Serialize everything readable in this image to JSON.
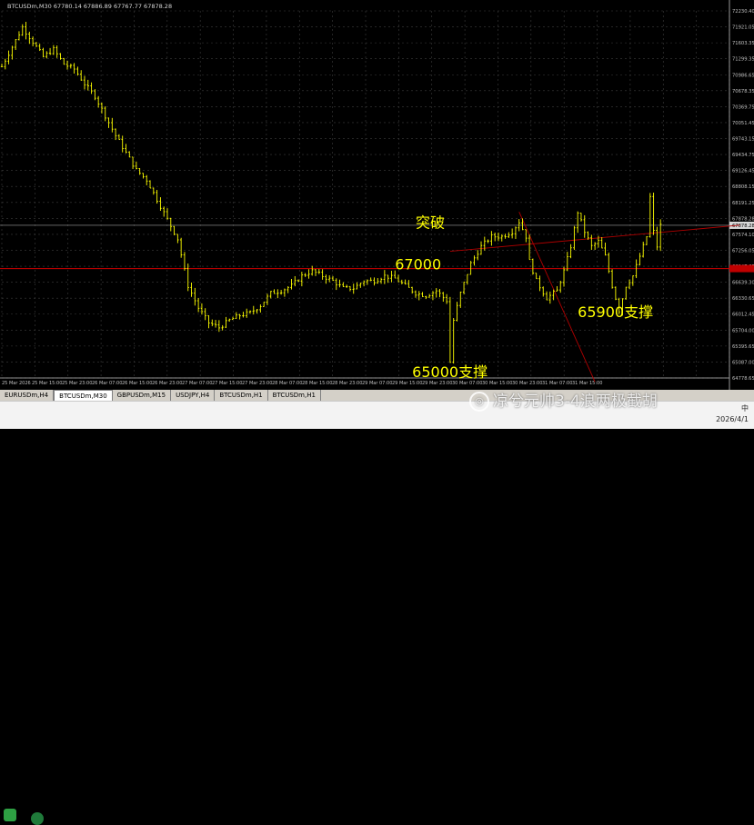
{
  "window": {
    "title": "BTCUSDm,M30  67780.14 67886.89 67767.77 67878.28"
  },
  "tabs": [
    {
      "label": "EURUSDm,H4",
      "active": false
    },
    {
      "label": "BTCUSDm,M30",
      "active": true
    },
    {
      "label": "GBPUSDm,M15",
      "active": false
    },
    {
      "label": "USDJPY,H4",
      "active": false
    },
    {
      "label": "BTCUSDm,H1",
      "active": false
    },
    {
      "label": "BTCUSDm,H1",
      "active": false
    }
  ],
  "taskbar": {
    "ime": "中",
    "date": "2026/4/1"
  },
  "watermark": "凉兮元帅3-4浪两极截胡",
  "colors": {
    "background": "#000000",
    "grid": "#3c3c3c",
    "bars": "#ffff00",
    "annotation_text": "#ffff00",
    "support_line": "#d00000",
    "trend_line": "#b00000",
    "bid_line": "#a0a0a0",
    "axis_text": "#c0c0c0",
    "price_tag": "#c00000"
  },
  "chart_data": {
    "type": "line",
    "symbol": "BTCUSDm",
    "timeframe": "M30",
    "ohlc": {
      "open": 67780.14,
      "high": 67886.89,
      "low": 67767.77,
      "close": 67878.28
    },
    "y_ticks": [
      "72230.40",
      "71921.05",
      "71603.35",
      "71299.35",
      "70986.65",
      "70678.35",
      "70369.75",
      "70051.45",
      "69743.15",
      "69434.75",
      "69126.45",
      "68808.15",
      "68191.25",
      "67878.28",
      "67574.10",
      "67256.05",
      "66947.65",
      "66639.30",
      "66330.65",
      "66012.45",
      "65704.00",
      "65395.65",
      "65087.00",
      "64778.65"
    ],
    "x_ticks": [
      "25 Mar 2026",
      "25 Mar 15:00",
      "25 Mar 23:00",
      "26 Mar 07:00",
      "26 Mar 15:00",
      "26 Mar 23:00",
      "27 Mar 07:00",
      "27 Mar 15:00",
      "27 Mar 23:00",
      "28 Mar 07:00",
      "28 Mar 15:00",
      "28 Mar 23:00",
      "29 Mar 07:00",
      "29 Mar 15:00",
      "29 Mar 23:00",
      "30 Mar 07:00",
      "30 Mar 15:00",
      "30 Mar 23:00",
      "31 Mar 07:00",
      "31 Mar 15:00"
    ],
    "price_path": [
      [
        0,
        71100
      ],
      [
        3,
        71500
      ],
      [
        6,
        71900
      ],
      [
        9,
        71600
      ],
      [
        12,
        71300
      ],
      [
        15,
        71450
      ],
      [
        18,
        71150
      ],
      [
        21,
        71050
      ],
      [
        24,
        70750
      ],
      [
        27,
        70500
      ],
      [
        30,
        70100
      ],
      [
        33,
        69700
      ],
      [
        36,
        69350
      ],
      [
        39,
        69000
      ],
      [
        42,
        68800
      ],
      [
        45,
        68400
      ],
      [
        48,
        68000
      ],
      [
        51,
        67600
      ],
      [
        54,
        66650
      ],
      [
        57,
        66200
      ],
      [
        60,
        65900
      ],
      [
        63,
        65800
      ],
      [
        66,
        65950
      ],
      [
        69,
        66050
      ],
      [
        72,
        66100
      ],
      [
        75,
        66250
      ],
      [
        78,
        66500
      ],
      [
        81,
        66550
      ],
      [
        84,
        66650
      ],
      [
        87,
        66850
      ],
      [
        90,
        66950
      ],
      [
        93,
        66850
      ],
      [
        96,
        66750
      ],
      [
        99,
        66600
      ],
      [
        102,
        66600
      ],
      [
        105,
        66750
      ],
      [
        108,
        66750
      ],
      [
        111,
        66850
      ],
      [
        114,
        66800
      ],
      [
        117,
        66650
      ],
      [
        120,
        66500
      ],
      [
        123,
        66450
      ],
      [
        126,
        66550
      ],
      [
        129,
        66350
      ],
      [
        130,
        65100
      ],
      [
        131,
        65950
      ],
      [
        133,
        66500
      ],
      [
        136,
        67100
      ],
      [
        139,
        67450
      ],
      [
        142,
        67650
      ],
      [
        145,
        67650
      ],
      [
        148,
        67750
      ],
      [
        150,
        67950
      ],
      [
        152,
        67650
      ],
      [
        153,
        67150
      ],
      [
        155,
        66750
      ],
      [
        158,
        66400
      ],
      [
        161,
        66550
      ],
      [
        163,
        66950
      ],
      [
        165,
        67450
      ],
      [
        167,
        68150
      ],
      [
        169,
        67750
      ],
      [
        171,
        67450
      ],
      [
        173,
        67550
      ],
      [
        175,
        67250
      ],
      [
        177,
        66650
      ],
      [
        179,
        66150
      ],
      [
        181,
        66650
      ],
      [
        183,
        66850
      ],
      [
        185,
        67250
      ],
      [
        187,
        67650
      ],
      [
        188,
        68450
      ],
      [
        189,
        67750
      ],
      [
        190,
        67450
      ],
      [
        191,
        67878
      ]
    ],
    "x_max": 191,
    "ylim": [
      64778.65,
      72230.4
    ],
    "current_price": "67878.28",
    "current_price_value": 67878.28,
    "support_level": {
      "value": 67000,
      "tag": "67000"
    },
    "trend_line": {
      "x1": 130,
      "y1": 67350,
      "x2": 214,
      "y2": 67880
    },
    "breakdown_line": {
      "x1": 150,
      "y1": 68150,
      "x2": 172,
      "y2": 64700
    },
    "annotations": [
      {
        "text": "突破",
        "x": 120,
        "y": 67830
      },
      {
        "text": "67000",
        "x": 114,
        "y": 66980
      },
      {
        "text": "65900支撑",
        "x": 167,
        "y": 66010
      },
      {
        "text": "65000支撑",
        "x": 119,
        "y": 64795
      }
    ],
    "grid": true
  }
}
